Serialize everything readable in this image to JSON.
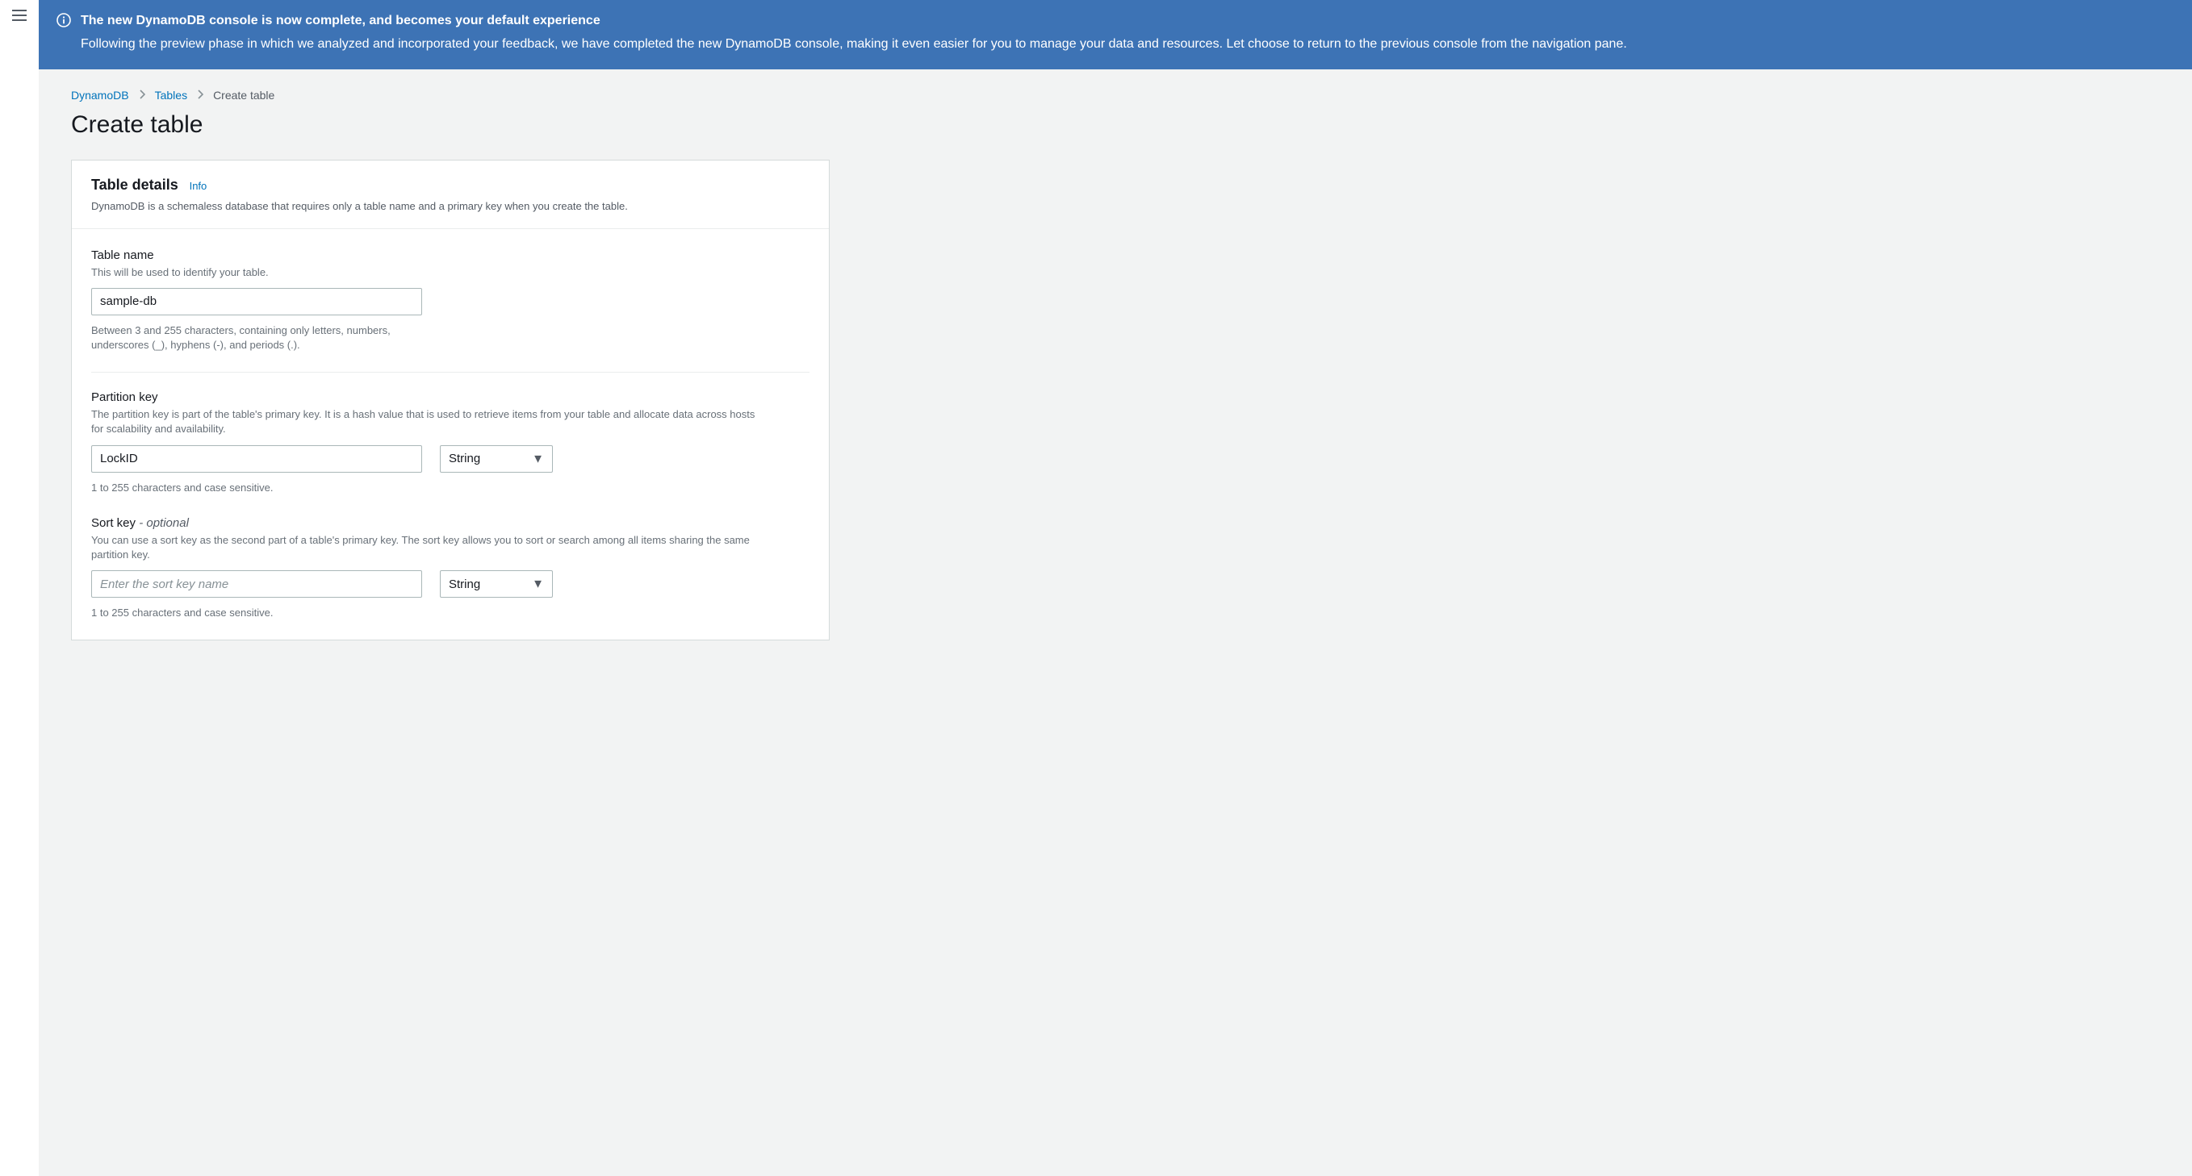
{
  "banner": {
    "title": "The new DynamoDB console is now complete, and becomes your default experience",
    "body": "Following the preview phase in which we analyzed and incorporated your feedback, we have completed the new DynamoDB console, making it even easier for you to manage your data and resources. Let choose to return to the previous console from the navigation pane."
  },
  "breadcrumbs": {
    "root": "DynamoDB",
    "tables": "Tables",
    "current": "Create table"
  },
  "page_title": "Create table",
  "card": {
    "heading": "Table details",
    "info_link": "Info",
    "subheading": "DynamoDB is a schemaless database that requires only a table name and a primary key when you create the table."
  },
  "table_name": {
    "label": "Table name",
    "desc": "This will be used to identify your table.",
    "value": "sample-db",
    "constraint": "Between 3 and 255 characters, containing only letters, numbers, underscores (_), hyphens (-), and periods (.)."
  },
  "partition_key": {
    "label": "Partition key",
    "desc": "The partition key is part of the table's primary key. It is a hash value that is used to retrieve items from your table and allocate data across hosts for scalability and availability.",
    "value": "LockID",
    "type": "String",
    "constraint": "1 to 255 characters and case sensitive."
  },
  "sort_key": {
    "label": "Sort key",
    "optional": " - optional",
    "desc": "You can use a sort key as the second part of a table's primary key. The sort key allows you to sort or search among all items sharing the same partition key.",
    "placeholder": "Enter the sort key name",
    "value": "",
    "type": "String",
    "constraint": "1 to 255 characters and case sensitive."
  }
}
